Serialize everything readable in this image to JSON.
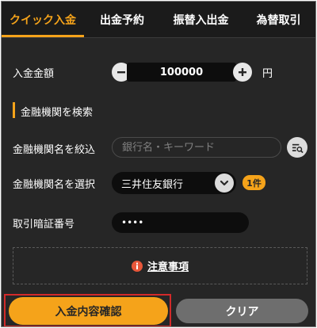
{
  "tabs": [
    {
      "label": "クイック入金",
      "active": true
    },
    {
      "label": "出金予約",
      "active": false
    },
    {
      "label": "振替入出金",
      "active": false
    },
    {
      "label": "為替取引",
      "active": false
    }
  ],
  "amount": {
    "label": "入金金額",
    "value": "100000",
    "unit": "円",
    "decrement_icon": "minus-icon",
    "increment_icon": "plus-icon"
  },
  "bank_search_section": {
    "title": "金融機関を検索"
  },
  "search": {
    "label": "金融機関名を絞込",
    "placeholder": "銀行名・キーワード",
    "value": "",
    "button_icon": "search-list-icon"
  },
  "bank_select": {
    "label": "金融機関名を選択",
    "selected": "三井住友銀行",
    "count_badge": "1件"
  },
  "pin": {
    "label": "取引暗証番号",
    "value": "••••"
  },
  "notice": {
    "icon": "info-icon",
    "label": "注意事項"
  },
  "buttons": {
    "confirm_label": "入金内容確認",
    "clear_label": "クリア"
  },
  "colors": {
    "accent": "#f5a31a",
    "background": "#262626",
    "highlight": "#d22a2a"
  }
}
